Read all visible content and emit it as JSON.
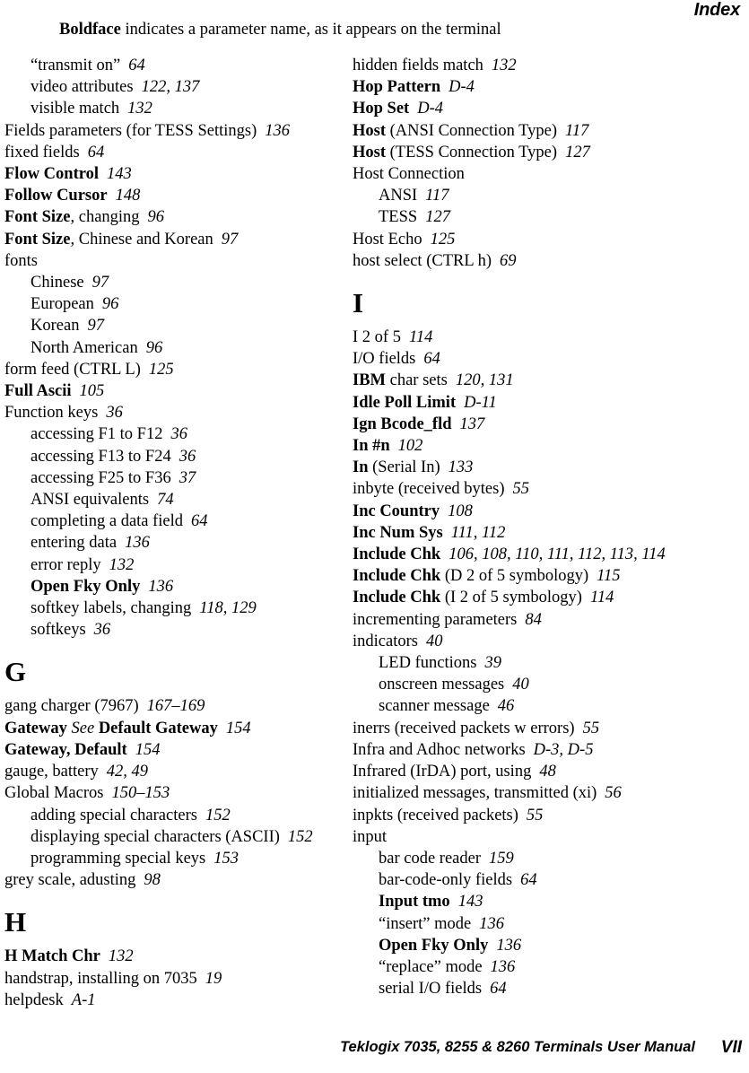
{
  "header": {
    "title": "Index",
    "note_bold": "Boldface",
    "note_rest": " indicates a parameter name, as it appears on the terminal"
  },
  "footer": {
    "manual_title": "Teklogix 7035, 8255 & 8260 Terminals User Manual",
    "page_number": "VII"
  },
  "columns": {
    "left": [
      {
        "kind": "entry",
        "level": 1,
        "label": "“transmit on”",
        "pages": "64"
      },
      {
        "kind": "entry",
        "level": 1,
        "label": "video attributes",
        "pages": "122, 137"
      },
      {
        "kind": "entry",
        "level": 1,
        "label": "visible match",
        "pages": "132"
      },
      {
        "kind": "entry",
        "level": 0,
        "label": "Fields parameters (for TESS Settings)",
        "pages": "136"
      },
      {
        "kind": "entry",
        "level": 0,
        "label": "fixed fields",
        "pages": "64"
      },
      {
        "kind": "entry",
        "level": 0,
        "label": "Flow Control",
        "bold": true,
        "pages": "143"
      },
      {
        "kind": "entry",
        "level": 0,
        "label": "Follow Cursor",
        "bold": true,
        "pages": "148"
      },
      {
        "kind": "entry",
        "level": 0,
        "label_bold": "Font Size",
        "label": ", changing",
        "pages": "96"
      },
      {
        "kind": "entry",
        "level": 0,
        "label_bold": "Font Size",
        "label": ", Chinese and Korean",
        "pages": "97"
      },
      {
        "kind": "entry",
        "level": 0,
        "label": "fonts",
        "pages": ""
      },
      {
        "kind": "entry",
        "level": 1,
        "label": "Chinese",
        "pages": "97"
      },
      {
        "kind": "entry",
        "level": 1,
        "label": "European",
        "pages": "96"
      },
      {
        "kind": "entry",
        "level": 1,
        "label": "Korean",
        "pages": "97"
      },
      {
        "kind": "entry",
        "level": 1,
        "label": "North American",
        "pages": "96"
      },
      {
        "kind": "entry",
        "level": 0,
        "label": "form feed (CTRL L)",
        "pages": "125"
      },
      {
        "kind": "entry",
        "level": 0,
        "label": "Full Ascii",
        "bold": true,
        "pages": "105"
      },
      {
        "kind": "entry",
        "level": 0,
        "label": "Function keys",
        "pages": "36"
      },
      {
        "kind": "entry",
        "level": 1,
        "label": "accessing F1 to F12",
        "pages": "36"
      },
      {
        "kind": "entry",
        "level": 1,
        "label": "accessing F13 to F24",
        "pages": "36"
      },
      {
        "kind": "entry",
        "level": 1,
        "label": "accessing F25 to F36",
        "pages": "37"
      },
      {
        "kind": "entry",
        "level": 1,
        "label": "ANSI equivalents",
        "pages": "74"
      },
      {
        "kind": "entry",
        "level": 1,
        "label": "completing a data field",
        "pages": "64"
      },
      {
        "kind": "entry",
        "level": 1,
        "label": "entering data",
        "pages": "136"
      },
      {
        "kind": "entry",
        "level": 1,
        "label": "error reply",
        "pages": "132"
      },
      {
        "kind": "entry",
        "level": 1,
        "label": "Open Fky Only",
        "bold": true,
        "pages": "136"
      },
      {
        "kind": "entry",
        "level": 1,
        "label": "softkey labels, changing",
        "pages": "118, 129"
      },
      {
        "kind": "entry",
        "level": 1,
        "label": "softkeys",
        "pages": "36"
      },
      {
        "kind": "letter",
        "letter": "G"
      },
      {
        "kind": "entry",
        "level": 0,
        "label": "gang charger (7967)",
        "pages": "167–169"
      },
      {
        "kind": "entry",
        "level": 0,
        "label_bold": "Gateway",
        "label_see": " See ",
        "label_bold2": "Default Gateway",
        "pages": "154"
      },
      {
        "kind": "entry",
        "level": 0,
        "label": "Gateway, Default",
        "bold": true,
        "pages": "154"
      },
      {
        "kind": "entry",
        "level": 0,
        "label": "gauge, battery",
        "pages": "42, 49"
      },
      {
        "kind": "entry",
        "level": 0,
        "label": "Global Macros",
        "pages": "150–153"
      },
      {
        "kind": "entry",
        "level": 1,
        "label": "adding special characters",
        "pages": "152"
      },
      {
        "kind": "entry",
        "level": 1,
        "label": "displaying special characters (ASCII)",
        "pages": "152"
      },
      {
        "kind": "entry",
        "level": 1,
        "label": "programming special keys",
        "pages": "153"
      },
      {
        "kind": "entry",
        "level": 0,
        "label": "grey scale, adusting",
        "pages": "98"
      },
      {
        "kind": "letter",
        "letter": "H"
      },
      {
        "kind": "entry",
        "level": 0,
        "label": "H Match Chr",
        "bold": true,
        "pages": "132"
      },
      {
        "kind": "entry",
        "level": 0,
        "label": "handstrap, installing on 7035",
        "pages": "19"
      },
      {
        "kind": "entry",
        "level": 0,
        "label": "helpdesk",
        "pages": "A-1"
      }
    ],
    "right": [
      {
        "kind": "entry",
        "level": 0,
        "label": "hidden fields match",
        "pages": "132"
      },
      {
        "kind": "entry",
        "level": 0,
        "label": "Hop Pattern",
        "bold": true,
        "pages": "D-4"
      },
      {
        "kind": "entry",
        "level": 0,
        "label": "Hop Set",
        "bold": true,
        "pages": "D-4"
      },
      {
        "kind": "entry",
        "level": 0,
        "label_bold": "Host",
        "label": " (ANSI Connection Type)",
        "pages": "117"
      },
      {
        "kind": "entry",
        "level": 0,
        "label_bold": "Host",
        "label": " (TESS Connection Type)",
        "pages": "127"
      },
      {
        "kind": "entry",
        "level": 0,
        "label": "Host Connection",
        "pages": ""
      },
      {
        "kind": "entry",
        "level": 1,
        "label": "ANSI",
        "pages": "117"
      },
      {
        "kind": "entry",
        "level": 1,
        "label": "TESS",
        "pages": "127"
      },
      {
        "kind": "entry",
        "level": 0,
        "label": "Host Echo",
        "pages": "125"
      },
      {
        "kind": "entry",
        "level": 0,
        "label": "host select (CTRL h)",
        "pages": "69"
      },
      {
        "kind": "letter",
        "letter": "I"
      },
      {
        "kind": "entry",
        "level": 0,
        "label": "I 2 of 5",
        "pages": "114"
      },
      {
        "kind": "entry",
        "level": 0,
        "label": "I/O fields",
        "pages": "64"
      },
      {
        "kind": "entry",
        "level": 0,
        "label_bold": "IBM",
        "label": "  char sets",
        "pages": "120, 131"
      },
      {
        "kind": "entry",
        "level": 0,
        "label": "Idle Poll Limit",
        "bold": true,
        "pages": "D-11"
      },
      {
        "kind": "entry",
        "level": 0,
        "label": "Ign Bcode_fld",
        "bold": true,
        "pages": "137"
      },
      {
        "kind": "entry",
        "level": 0,
        "label": "In #n",
        "bold": true,
        "pages": "102"
      },
      {
        "kind": "entry",
        "level": 0,
        "label_bold": "In",
        "label": " (Serial In)",
        "pages": "133"
      },
      {
        "kind": "entry",
        "level": 0,
        "label": "inbyte (received bytes)",
        "pages": "55"
      },
      {
        "kind": "entry",
        "level": 0,
        "label": "Inc Country",
        "bold": true,
        "pages": "108"
      },
      {
        "kind": "entry",
        "level": 0,
        "label": "Inc Num Sys",
        "bold": true,
        "pages": "111, 112"
      },
      {
        "kind": "entry",
        "level": 0,
        "label": "Include Chk",
        "bold": true,
        "pages": "106, 108, 110, 111, 112, 113, 114"
      },
      {
        "kind": "entry",
        "level": 0,
        "label_bold": "Include Chk",
        "label": " (D 2 of 5 symbology)",
        "pages": "115"
      },
      {
        "kind": "entry",
        "level": 0,
        "label_bold": "Include Chk",
        "label": " (I 2 of 5 symbology)",
        "pages": "114"
      },
      {
        "kind": "entry",
        "level": 0,
        "label": "incrementing parameters",
        "pages": "84"
      },
      {
        "kind": "entry",
        "level": 0,
        "label": "indicators",
        "pages": "40"
      },
      {
        "kind": "entry",
        "level": 1,
        "label": "LED functions",
        "pages": "39"
      },
      {
        "kind": "entry",
        "level": 1,
        "label": "onscreen messages",
        "pages": "40"
      },
      {
        "kind": "entry",
        "level": 1,
        "label": "scanner message",
        "pages": "46"
      },
      {
        "kind": "entry",
        "level": 0,
        "label": "inerrs (received packets w errors)",
        "pages": "55"
      },
      {
        "kind": "entry",
        "level": 0,
        "label": "Infra and Adhoc networks",
        "pages": "D-3, D-5"
      },
      {
        "kind": "entry",
        "level": 0,
        "label": "Infrared (IrDA) port, using",
        "pages": "48"
      },
      {
        "kind": "entry",
        "level": 0,
        "label": "initialized messages, transmitted (xi)",
        "pages": "56"
      },
      {
        "kind": "entry",
        "level": 0,
        "label": "inpkts (received packets)",
        "pages": "55"
      },
      {
        "kind": "entry",
        "level": 0,
        "label": "input",
        "pages": ""
      },
      {
        "kind": "entry",
        "level": 1,
        "label": "bar code reader",
        "pages": "159"
      },
      {
        "kind": "entry",
        "level": 1,
        "label": "bar-code-only fields",
        "pages": "64"
      },
      {
        "kind": "entry",
        "level": 1,
        "label": "Input tmo",
        "bold": true,
        "pages": "143"
      },
      {
        "kind": "entry",
        "level": 1,
        "label": "“insert” mode",
        "pages": "136"
      },
      {
        "kind": "entry",
        "level": 1,
        "label": "Open Fky Only",
        "bold": true,
        "pages": "136"
      },
      {
        "kind": "entry",
        "level": 1,
        "label": "“replace” mode",
        "pages": "136"
      },
      {
        "kind": "entry",
        "level": 1,
        "label": "serial I/O fields",
        "pages": "64"
      }
    ]
  }
}
